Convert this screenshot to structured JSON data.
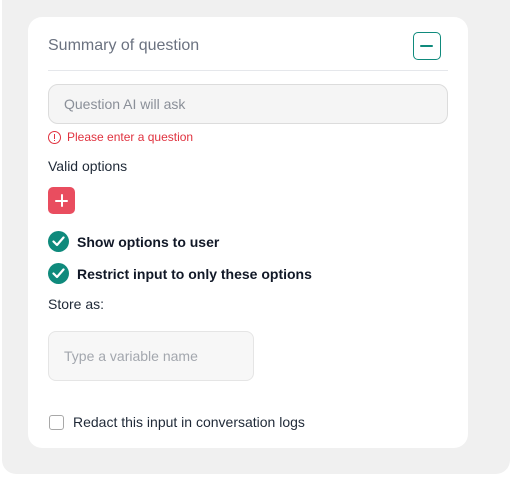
{
  "card": {
    "title": "Summary of question",
    "collapse_icon": "minus-icon"
  },
  "question": {
    "placeholder": "Question AI will ask",
    "value": ""
  },
  "error": {
    "icon": "alert-circle-icon",
    "message": "Please enter a question"
  },
  "options": {
    "label": "Valid options",
    "add_icon": "plus-icon"
  },
  "checks": [
    {
      "label": "Show options to user",
      "checked": true
    },
    {
      "label": "Restrict input to only these options",
      "checked": true
    }
  ],
  "store": {
    "label": "Store as:",
    "placeholder": "Type a variable name",
    "value": ""
  },
  "redact": {
    "label": "Redact this input in conversation logs",
    "checked": false
  },
  "colors": {
    "teal": "#0f8a7c",
    "error_red": "#e0323f",
    "add_button": "#e94d5f"
  }
}
